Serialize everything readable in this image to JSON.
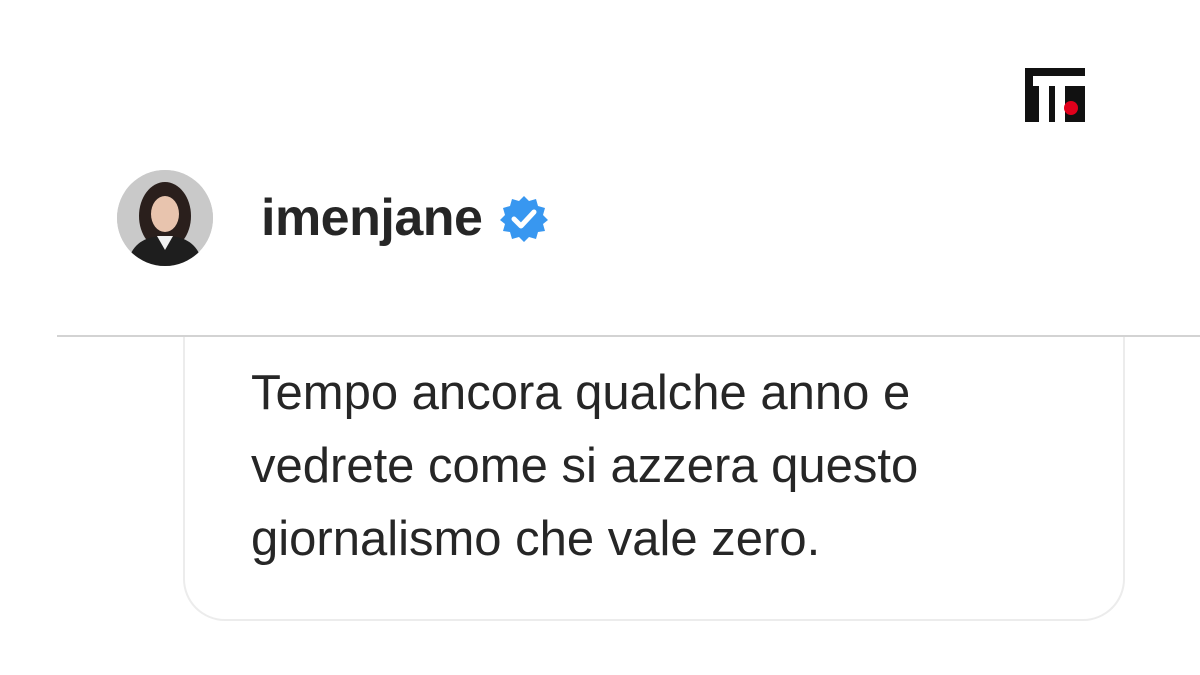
{
  "profile": {
    "username": "imenjane",
    "verified": true,
    "verified_badge_color": "#3897f0"
  },
  "comment": {
    "lines": [
      "Tempo ancora qualche anno e",
      "vedrete come si azzera questo",
      "giornalismo che vale zero."
    ]
  },
  "brand": {
    "logo_icon": "publisher-logo-icon",
    "logo_color": "#111111",
    "accent_color": "#e0001b"
  },
  "colors": {
    "text": "#262626",
    "background": "#ffffff",
    "divider": "#d3d3d3"
  }
}
